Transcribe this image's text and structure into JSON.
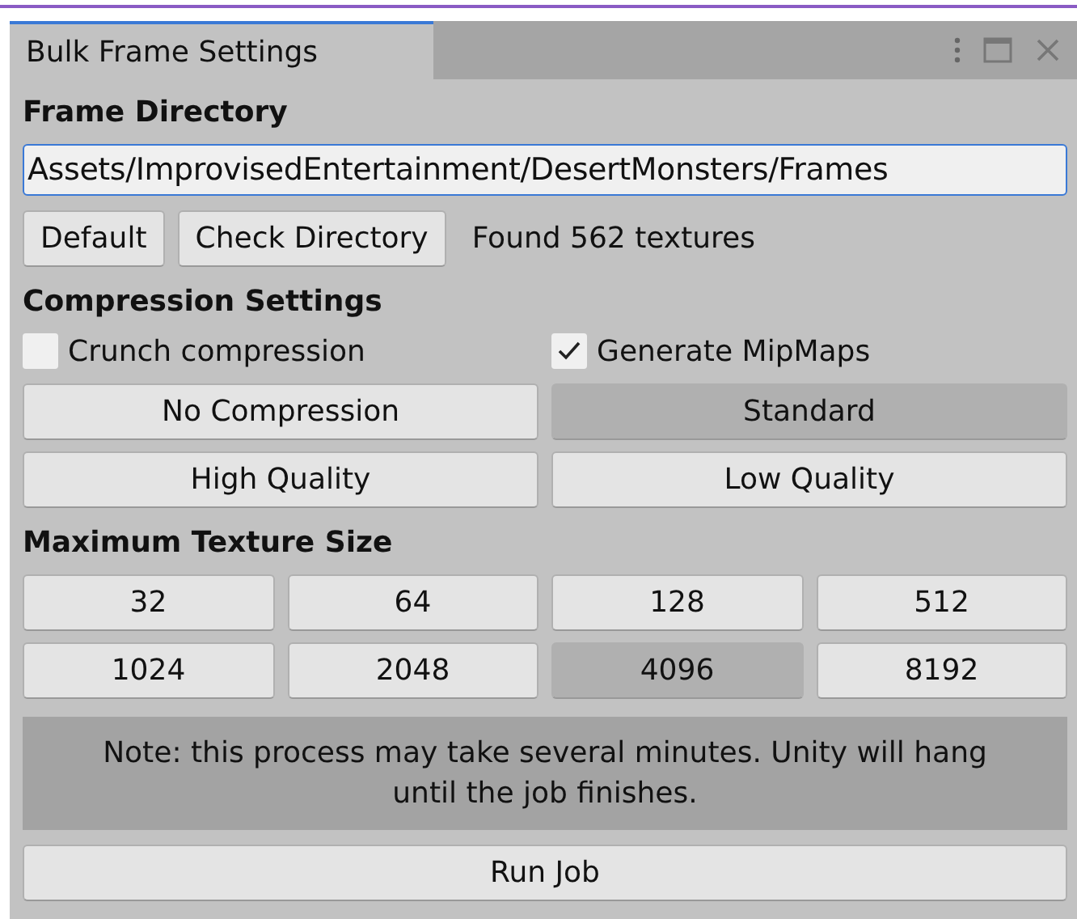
{
  "window": {
    "tab": "Bulk Frame Settings"
  },
  "frame_directory": {
    "heading": "Frame Directory",
    "value": "Assets/ImprovisedEntertainment/DesertMonsters/Frames",
    "buttons": [
      "Default",
      "Check Directory"
    ],
    "status": "Found 562 textures"
  },
  "compression": {
    "heading": "Compression Settings",
    "checkboxes": [
      {
        "label": "Crunch compression",
        "checked": false
      },
      {
        "label": "Generate MipMaps",
        "checked": true
      }
    ],
    "options": [
      {
        "label": "No Compression",
        "selected": false
      },
      {
        "label": "Standard",
        "selected": true
      },
      {
        "label": "High Quality",
        "selected": false
      },
      {
        "label": "Low Quality",
        "selected": false
      }
    ]
  },
  "texture_size": {
    "heading": "Maximum Texture Size",
    "options": [
      {
        "label": "32",
        "selected": false
      },
      {
        "label": "64",
        "selected": false
      },
      {
        "label": "128",
        "selected": false
      },
      {
        "label": "512",
        "selected": false
      },
      {
        "label": "1024",
        "selected": false
      },
      {
        "label": "2048",
        "selected": false
      },
      {
        "label": "4096",
        "selected": true
      },
      {
        "label": "8192",
        "selected": false
      }
    ]
  },
  "note": "Note: this process may take several minutes. Unity will hang until the job finishes.",
  "run_button": "Run Job"
}
